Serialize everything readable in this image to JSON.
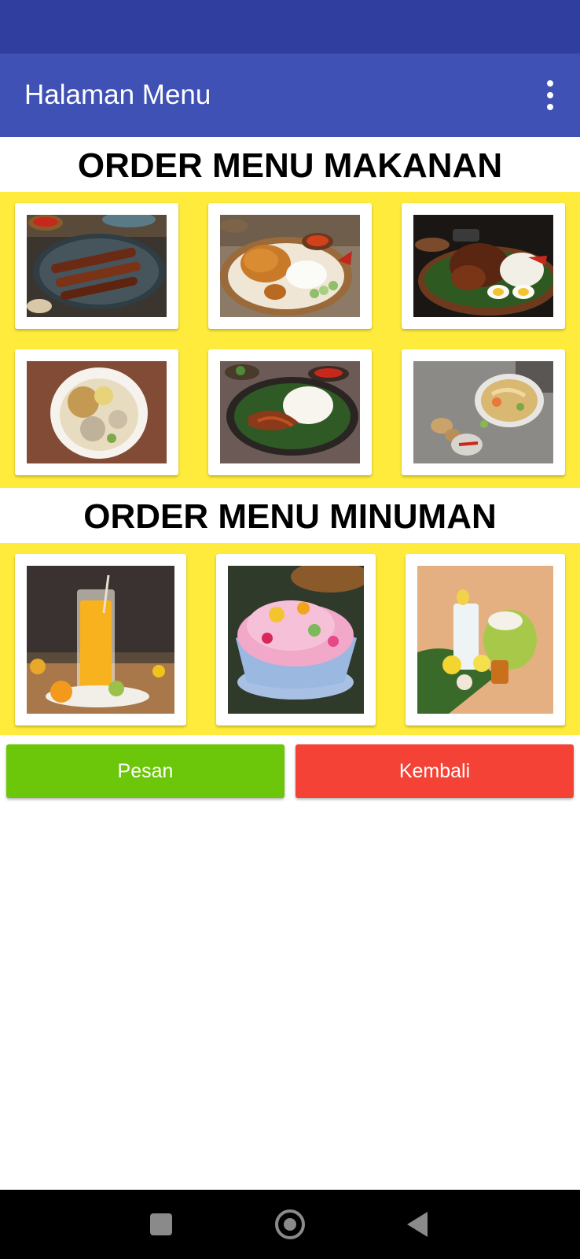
{
  "app_bar": {
    "title": "Halaman Menu",
    "overflow_icon": "more-vert-icon"
  },
  "food_section": {
    "title": "ORDER MENU MAKANAN",
    "items": [
      {
        "name": "sate"
      },
      {
        "name": "ayam goreng"
      },
      {
        "name": "bebek"
      },
      {
        "name": "bakso"
      },
      {
        "name": "ikan"
      },
      {
        "name": "soto"
      }
    ]
  },
  "drink_section": {
    "title": "ORDER MENU MINUMAN",
    "items": [
      {
        "name": "es jeruk"
      },
      {
        "name": "es campur"
      },
      {
        "name": "es kelapa"
      }
    ]
  },
  "actions": {
    "order_label": "Pesan",
    "back_label": "Kembali"
  },
  "colors": {
    "status_bar": "#303F9F",
    "app_bar": "#3F51B5",
    "panel": "#FFEB3B",
    "order_button": "#6CC70A",
    "back_button": "#F44336"
  },
  "navigation": {
    "recents_icon": "square-icon",
    "home_icon": "circle-home-icon",
    "back_icon": "triangle-back-icon"
  }
}
